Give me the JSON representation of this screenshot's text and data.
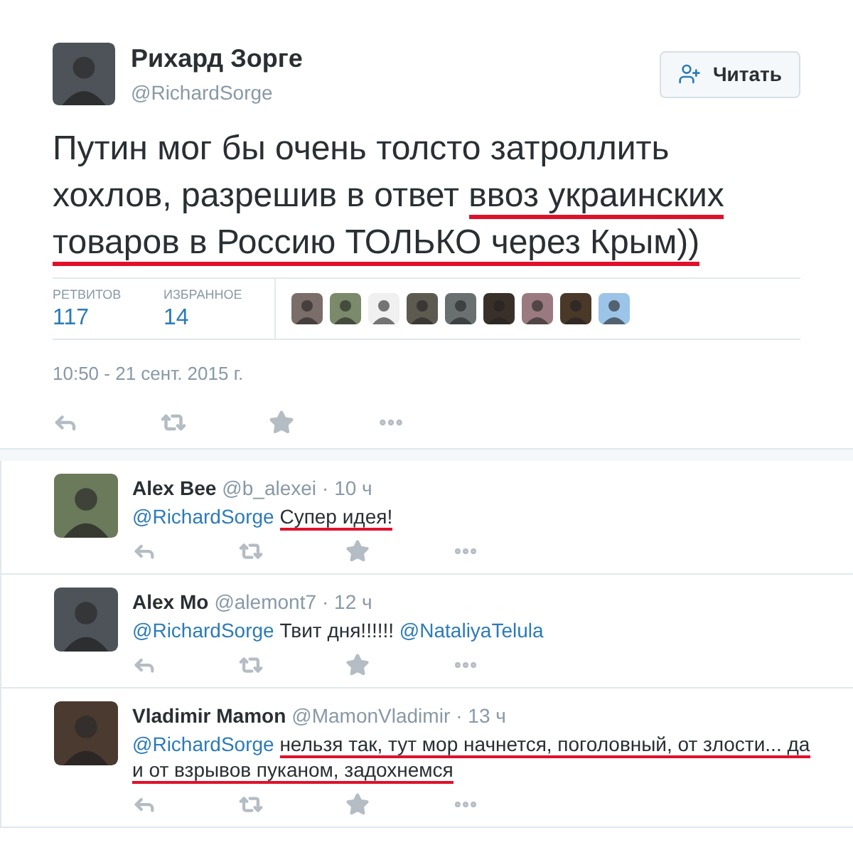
{
  "tweet": {
    "name": "Рихард Зорге",
    "handle": "@RichardSorge",
    "follow_button": "Читать",
    "body": [
      {
        "text": "Путин мог бы очень толсто затроллить хохлов, разрешив в ответ ",
        "underlined": false
      },
      {
        "text": "ввоз украинских товаров в Россию ТОЛЬКО через Крым))",
        "underlined": true
      }
    ],
    "stats": [
      {
        "label": "РЕТВИТОВ",
        "value": "117"
      },
      {
        "label": "ИЗБРАННОЕ",
        "value": "14"
      }
    ],
    "timestamp": "10:50 - 21 сент. 2015 г."
  },
  "replies": [
    {
      "name": "Alex Bee",
      "handle": "@b_alexei",
      "time": "· 10 ч",
      "parts": [
        {
          "kind": "mention",
          "text": "@RichardSorge",
          "underlined": false
        },
        {
          "kind": "text",
          "text": "Супер идея!",
          "underlined": true
        }
      ]
    },
    {
      "name": "Alex Mo",
      "handle": "@alemont7",
      "time": "· 12 ч",
      "parts": [
        {
          "kind": "mention",
          "text": "@RichardSorge",
          "underlined": false
        },
        {
          "kind": "text",
          "text": "Твит дня!!!!!!",
          "underlined": false
        },
        {
          "kind": "mention",
          "text": "@NataliyaTelula",
          "underlined": false
        }
      ]
    },
    {
      "name": "Vladimir Mamon",
      "handle": "@MamonVladimir",
      "time": "· 13 ч",
      "parts": [
        {
          "kind": "mention",
          "text": "@RichardSorge",
          "underlined": false
        },
        {
          "kind": "text",
          "text": "нельзя так, тут мор начнется, поголовный, от злости... да и от взрывов пуканом, задохнемся",
          "underlined": true
        }
      ]
    }
  ]
}
